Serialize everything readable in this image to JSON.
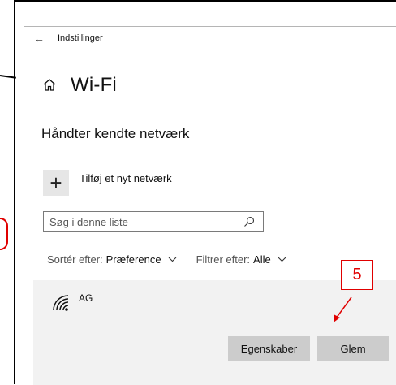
{
  "titlebar": {
    "back_glyph": "←",
    "title": "Indstillinger"
  },
  "header": {
    "title": "Wi-Fi"
  },
  "section": {
    "title": "Håndter kendte netværk"
  },
  "add_network": {
    "plus_glyph": "+",
    "label": "Tilføj et nyt netværk"
  },
  "search": {
    "placeholder": "Søg i denne liste",
    "value": ""
  },
  "filters": {
    "sort": {
      "label": "Sortér efter:",
      "value": "Præference"
    },
    "filter": {
      "label": "Filtrer efter:",
      "value": "Alle"
    }
  },
  "networks": [
    {
      "name": "AG",
      "icon": "wifi-signal-icon"
    }
  ],
  "buttons": {
    "properties": "Egenskaber",
    "forget": "Glem"
  },
  "callout": {
    "number": "5"
  },
  "colors": {
    "accent_red": "#e00000",
    "panel_bg": "#f2f2f2",
    "button_bg": "#cccccc"
  }
}
